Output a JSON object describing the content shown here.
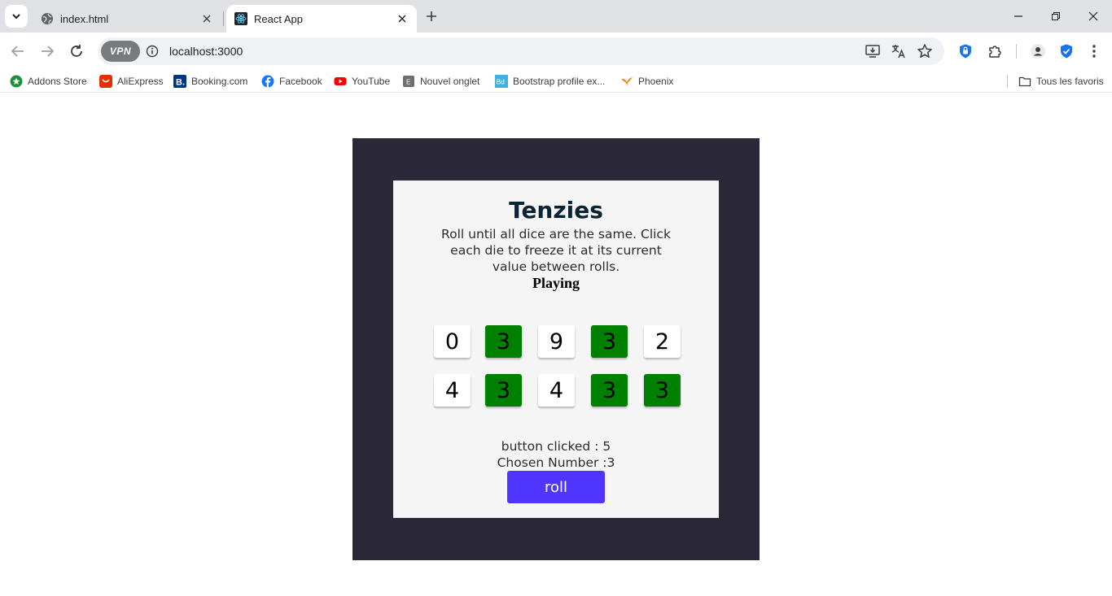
{
  "browser": {
    "tabs": [
      {
        "title": "index.html",
        "active": false
      },
      {
        "title": "React App",
        "active": true
      }
    ],
    "url": "localhost:3000",
    "vpn_label": "VPN",
    "bookmarks": [
      {
        "label": "Addons Store",
        "icon": "addons-store-icon",
        "color": "#1e8e3e"
      },
      {
        "label": "AliExpress",
        "icon": "aliexpress-icon",
        "color": "#e62e04"
      },
      {
        "label": "Booking.com",
        "icon": "booking-icon",
        "color": "#003580"
      },
      {
        "label": "Facebook",
        "icon": "facebook-icon",
        "color": "#1877f2"
      },
      {
        "label": "YouTube",
        "icon": "youtube-icon",
        "color": "#ff0000"
      },
      {
        "label": "Nouvel onglet",
        "icon": "new-tab-icon",
        "color": "#5f6368"
      },
      {
        "label": "Bootstrap profile ex...",
        "icon": "bootstrap-icon",
        "color": "#3eb3e0"
      },
      {
        "label": "Phoenix",
        "icon": "phoenix-icon",
        "color": "#f08a24"
      }
    ],
    "all_bookmarks_label": "Tous les favoris"
  },
  "app": {
    "title": "Tenzies",
    "instructions": "Roll until all dice are the same. Click each die to freeze it at its current value between rolls.",
    "status": "Playing",
    "dice": [
      {
        "value": "0",
        "held": false
      },
      {
        "value": "3",
        "held": true
      },
      {
        "value": "9",
        "held": false
      },
      {
        "value": "3",
        "held": true
      },
      {
        "value": "2",
        "held": false
      },
      {
        "value": "4",
        "held": false
      },
      {
        "value": "3",
        "held": true
      },
      {
        "value": "4",
        "held": false
      },
      {
        "value": "3",
        "held": true
      },
      {
        "value": "3",
        "held": true
      }
    ],
    "clicks_text": "button clicked : 5",
    "chosen_text": "Chosen Number :3",
    "roll_label": "roll",
    "colors": {
      "background": "#2b283a",
      "card": "#f5f5f5",
      "held_die": "#008000",
      "button": "#5035ff"
    }
  }
}
